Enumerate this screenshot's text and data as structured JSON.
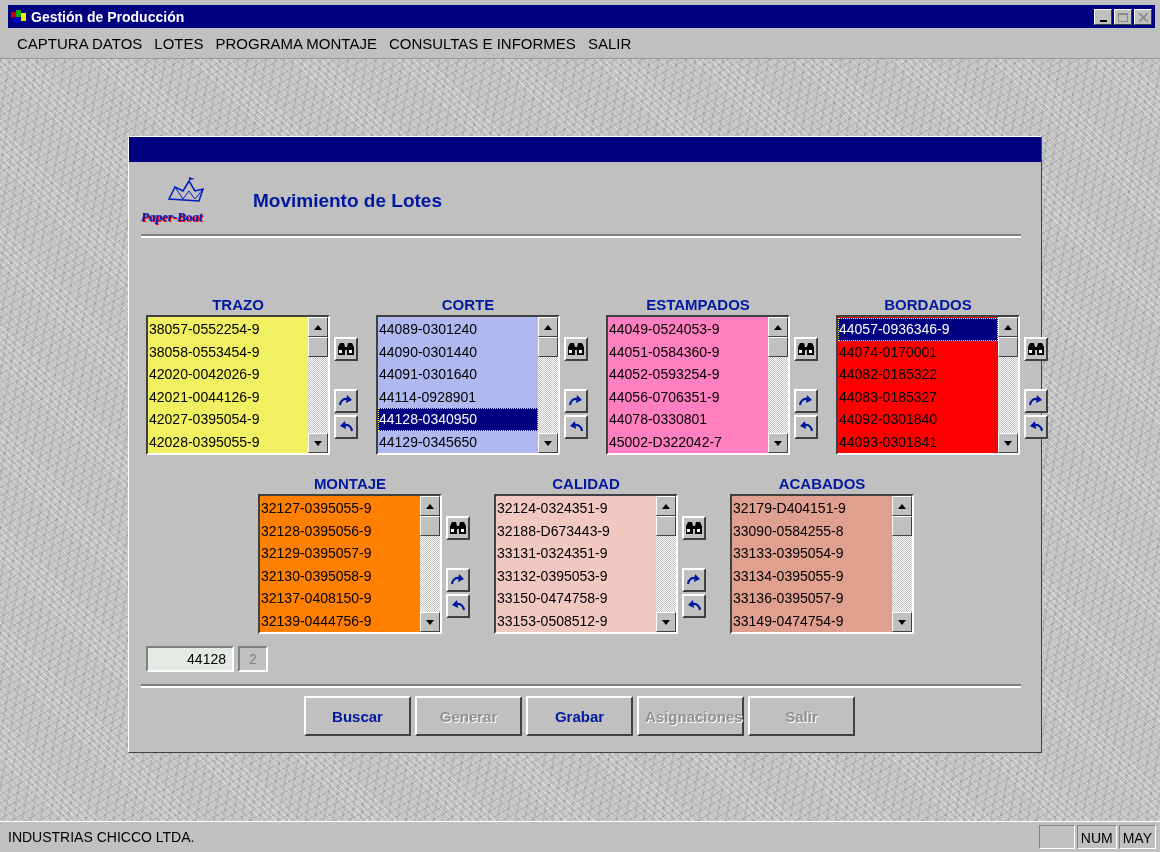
{
  "window": {
    "title": "Gestión de Producción"
  },
  "menu": [
    {
      "label": "CAPTURA DATOS"
    },
    {
      "label": "LOTES"
    },
    {
      "label": "PROGRAMA MONTAJE"
    },
    {
      "label": "CONSULTAS E INFORMES"
    },
    {
      "label": "SALIR"
    }
  ],
  "dialog": {
    "logo_text": "Paper-Boat",
    "title": "Movimiento de Lotes"
  },
  "list_rows": [
    {
      "lists": [
        {
          "title": "TRAZO",
          "color": "#f0f060",
          "tools": true,
          "items": [
            {
              "text": "38057-0552254-9",
              "selected": false
            },
            {
              "text": "38058-0553454-9",
              "selected": false
            },
            {
              "text": "42020-0042026-9",
              "selected": false
            },
            {
              "text": "42021-0044126-9",
              "selected": false
            },
            {
              "text": "42027-0395054-9",
              "selected": false
            },
            {
              "text": "42028-0395055-9",
              "selected": false
            }
          ]
        },
        {
          "title": "CORTE",
          "color": "#b0b8f0",
          "tools": true,
          "items": [
            {
              "text": "44089-0301240",
              "selected": false
            },
            {
              "text": "44090-0301440",
              "selected": false
            },
            {
              "text": "44091-0301640",
              "selected": false
            },
            {
              "text": "44114-0928901",
              "selected": false
            },
            {
              "text": "44128-0340950",
              "selected": true
            },
            {
              "text": "44129-0345650",
              "selected": false
            }
          ]
        },
        {
          "title": "ESTAMPADOS",
          "color": "#ff80c0",
          "tools": true,
          "items": [
            {
              "text": "44049-0524053-9",
              "selected": false
            },
            {
              "text": "44051-0584360-9",
              "selected": false
            },
            {
              "text": "44052-0593254-9",
              "selected": false
            },
            {
              "text": "44056-0706351-9",
              "selected": false
            },
            {
              "text": "44078-0330801",
              "selected": false
            },
            {
              "text": "45002-D322042-7",
              "selected": false
            }
          ]
        },
        {
          "title": "BORDADOS",
          "color": "#ff0000",
          "tools": true,
          "items": [
            {
              "text": "44057-0936346-9",
              "selected": true
            },
            {
              "text": "44074-0170001",
              "selected": false
            },
            {
              "text": "44082-0185322",
              "selected": false
            },
            {
              "text": "44083-0185327",
              "selected": false
            },
            {
              "text": "44092-0301840",
              "selected": false
            },
            {
              "text": "44093-0301841",
              "selected": false
            }
          ]
        }
      ]
    },
    {
      "lists": [
        {
          "title": "MONTAJE",
          "color": "#ff8000",
          "tools": true,
          "items": [
            {
              "text": "32127-0395055-9",
              "selected": false
            },
            {
              "text": "32128-0395056-9",
              "selected": false
            },
            {
              "text": "32129-0395057-9",
              "selected": false
            },
            {
              "text": "32130-0395058-9",
              "selected": false
            },
            {
              "text": "32137-0408150-9",
              "selected": false
            },
            {
              "text": "32139-0444756-9",
              "selected": false
            }
          ]
        },
        {
          "title": "CALIDAD",
          "color": "#f0c8c0",
          "tools": true,
          "items": [
            {
              "text": "32124-0324351-9",
              "selected": false
            },
            {
              "text": "32188-D673443-9",
              "selected": false
            },
            {
              "text": "33131-0324351-9",
              "selected": false
            },
            {
              "text": "33132-0395053-9",
              "selected": false
            },
            {
              "text": "33150-0474758-9",
              "selected": false
            },
            {
              "text": "33153-0508512-9",
              "selected": false
            }
          ]
        },
        {
          "title": "ACABADOS",
          "color": "#e0a090",
          "tools": false,
          "items": [
            {
              "text": "32179-D404151-9",
              "selected": false
            },
            {
              "text": "33090-0584255-8",
              "selected": false
            },
            {
              "text": "33133-0395054-9",
              "selected": false
            },
            {
              "text": "33134-0395055-9",
              "selected": false
            },
            {
              "text": "33136-0395057-9",
              "selected": false
            },
            {
              "text": "33149-0474754-9",
              "selected": false
            }
          ]
        }
      ]
    }
  ],
  "lot_field": {
    "value": "44128"
  },
  "count_field": {
    "value": "2",
    "disabled": true
  },
  "buttons": [
    {
      "label": "Buscar",
      "disabled": false
    },
    {
      "label": "Generar",
      "disabled": true
    },
    {
      "label": "Grabar",
      "disabled": false
    },
    {
      "label": "Asignaciones",
      "disabled": true
    },
    {
      "label": "Salir",
      "disabled": true
    }
  ],
  "status_bar": {
    "text": "INDUSTRIAS CHICCO LTDA.",
    "panels": [
      {
        "text": "NUM"
      },
      {
        "text": "MAY"
      }
    ]
  }
}
